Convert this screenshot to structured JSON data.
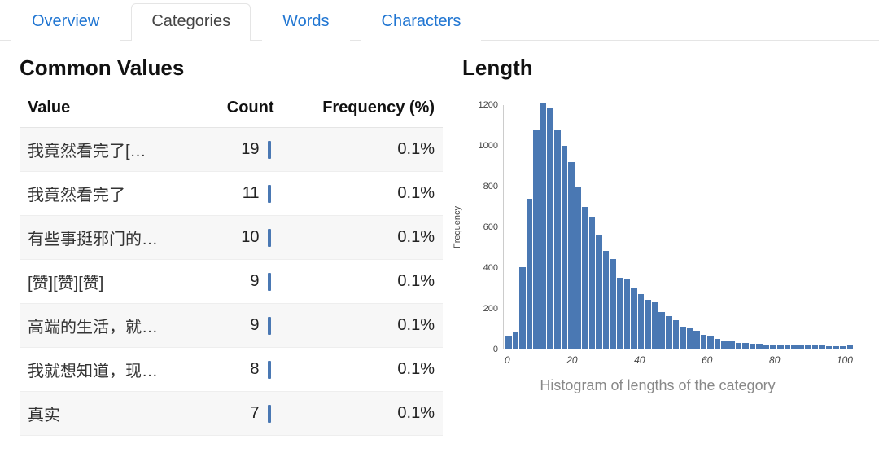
{
  "tabs": {
    "overview": "Overview",
    "categories": "Categories",
    "words": "Words",
    "characters": "Characters",
    "active": "categories"
  },
  "common_values": {
    "title": "Common Values",
    "headers": {
      "value": "Value",
      "count": "Count",
      "freq": "Frequency (%)"
    },
    "rows": [
      {
        "value": "我竟然看完了[…",
        "count": 19,
        "freq": "0.1%"
      },
      {
        "value": "我竟然看完了",
        "count": 11,
        "freq": "0.1%"
      },
      {
        "value": "有些事挺邪门的…",
        "count": 10,
        "freq": "0.1%"
      },
      {
        "value": "[赞][赞][赞]",
        "count": 9,
        "freq": "0.1%"
      },
      {
        "value": "高端的生活，就…",
        "count": 9,
        "freq": "0.1%"
      },
      {
        "value": "我就想知道，现…",
        "count": 8,
        "freq": "0.1%"
      },
      {
        "value": "真实",
        "count": 7,
        "freq": "0.1%"
      }
    ]
  },
  "length": {
    "title": "Length",
    "caption": "Histogram of lengths of the category",
    "ylabel": "Frequency"
  },
  "chart_data": {
    "type": "bar",
    "title": "Histogram of lengths of the category",
    "xlabel": "",
    "ylabel": "Frequency",
    "ylim": [
      0,
      1200
    ],
    "xlim": [
      0,
      100
    ],
    "xticks": [
      0,
      20,
      40,
      60,
      80,
      100
    ],
    "yticks": [
      0,
      200,
      400,
      600,
      800,
      1000,
      1200
    ],
    "bin_width": 2,
    "categories": [
      0,
      2,
      4,
      6,
      8,
      10,
      12,
      14,
      16,
      18,
      20,
      22,
      24,
      26,
      28,
      30,
      32,
      34,
      36,
      38,
      40,
      42,
      44,
      46,
      48,
      50,
      52,
      54,
      56,
      58,
      60,
      62,
      64,
      66,
      68,
      70,
      72,
      74,
      76,
      78,
      80,
      82,
      84,
      86,
      88,
      90,
      92,
      94,
      96,
      98
    ],
    "values": [
      60,
      80,
      400,
      740,
      1080,
      1210,
      1190,
      1080,
      1000,
      920,
      800,
      700,
      650,
      560,
      480,
      440,
      350,
      340,
      300,
      270,
      240,
      230,
      180,
      160,
      140,
      110,
      100,
      90,
      70,
      60,
      50,
      40,
      40,
      30,
      30,
      25,
      25,
      20,
      20,
      20,
      18,
      18,
      16,
      16,
      15,
      15,
      14,
      14,
      14,
      20
    ]
  }
}
